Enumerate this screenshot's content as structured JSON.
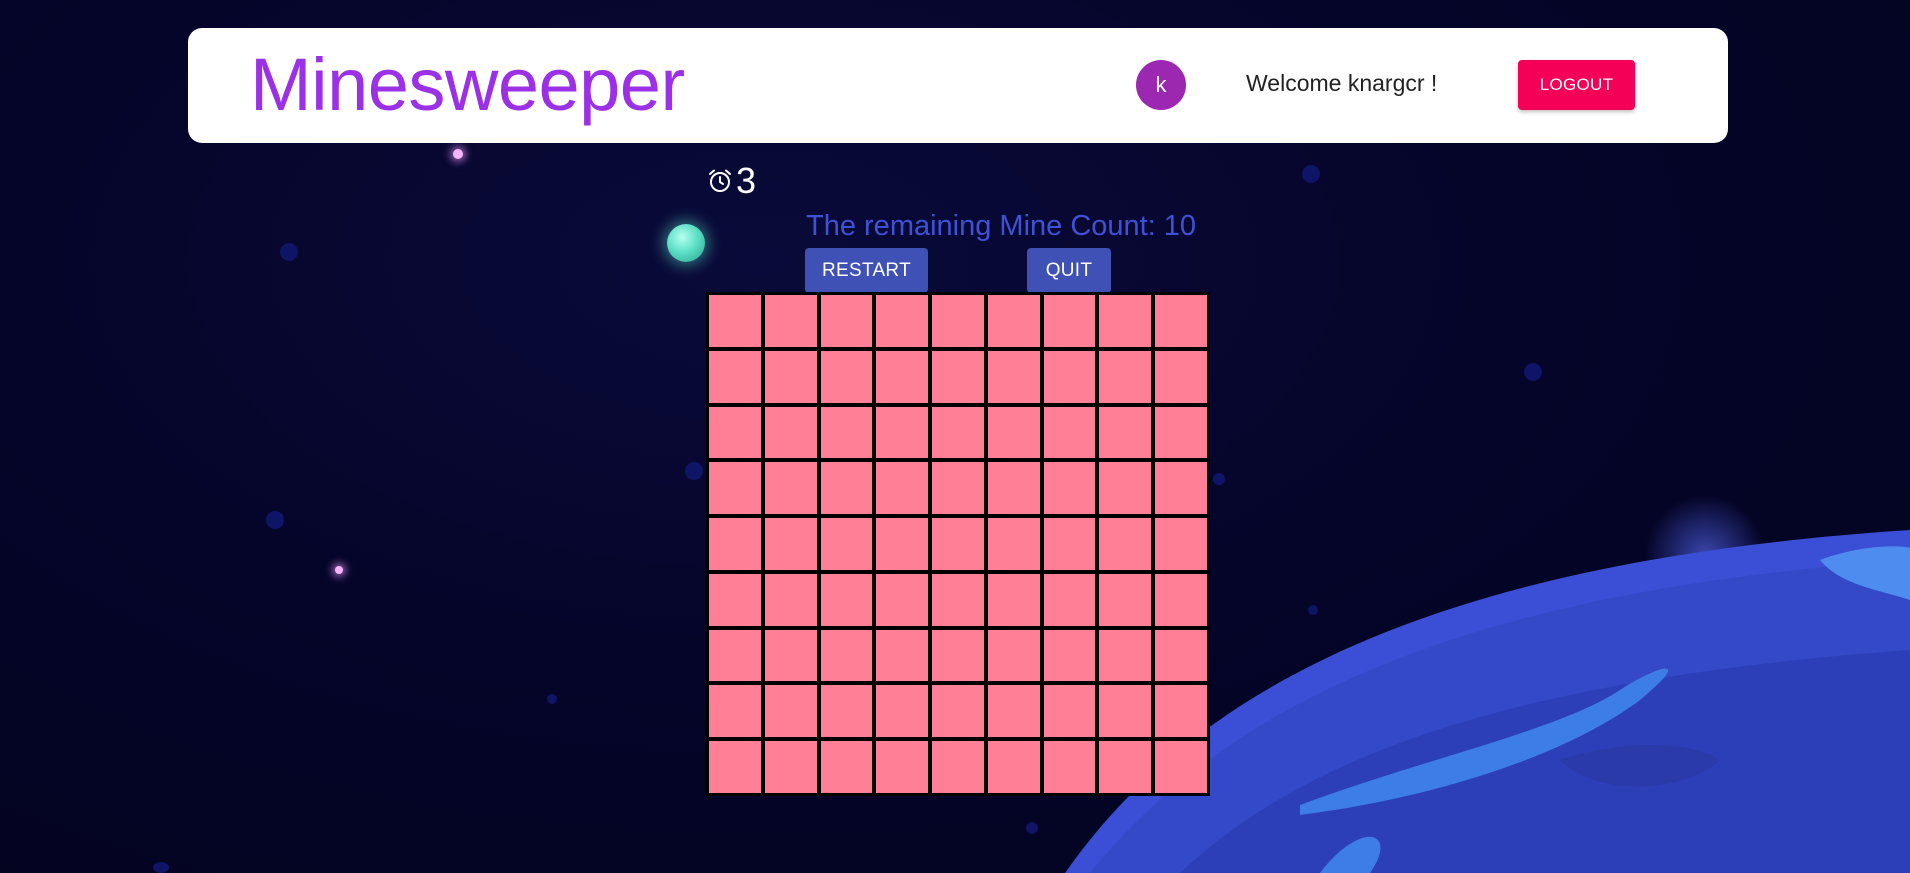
{
  "header": {
    "title": "Minesweeper",
    "avatar_initial": "k",
    "welcome_text": "Welcome knargcr !",
    "logout_label": "LOGOUT"
  },
  "game": {
    "timer_icon": "alarm-clock-icon",
    "timer_value": "3",
    "mine_count_label": "The remaining Mine Count:",
    "mine_count_value": "10",
    "restart_label": "RESTART",
    "quit_label": "QUIT",
    "board": {
      "rows": 9,
      "columns": 9,
      "cell_state": "unrevealed"
    }
  },
  "colors": {
    "brand": "#9b30e6",
    "avatar": "#9c27b0",
    "logout": "#f50057",
    "primary_button": "#3f51b5",
    "mine_count_text": "#3f51d6",
    "cell_unrevealed": "#ff8096",
    "background": "#05052a"
  }
}
